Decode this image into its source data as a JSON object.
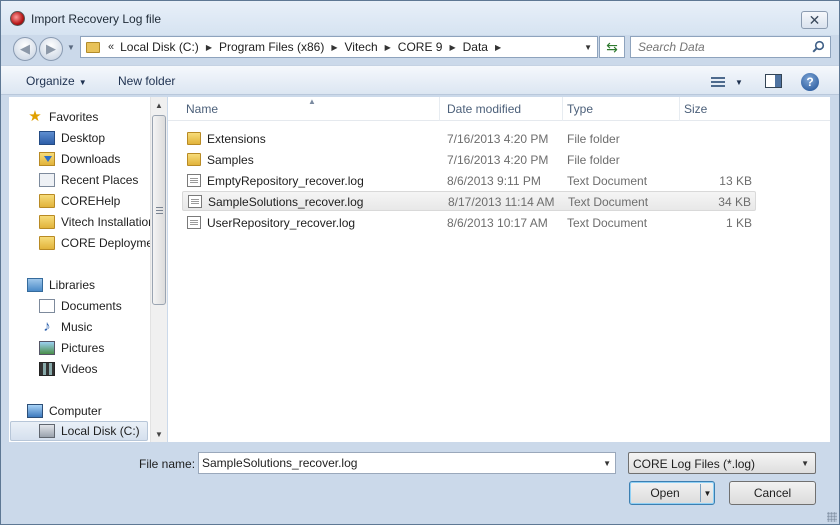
{
  "window": {
    "title": "Import Recovery Log file",
    "close_glyph": "✕"
  },
  "address": {
    "overflow": "«",
    "crumbs": [
      "Local Disk (C:)",
      "Program Files (x86)",
      "Vitech",
      "CORE 9",
      "Data"
    ],
    "search_placeholder": "Search Data"
  },
  "toolbar": {
    "organize_label": "Organize",
    "new_folder_label": "New folder",
    "help_glyph": "?"
  },
  "nav": {
    "favorites_label": "Favorites",
    "favorites": [
      "Desktop",
      "Downloads",
      "Recent Places",
      "COREHelp",
      "Vitech Installation",
      "CORE Deployment"
    ],
    "libraries_label": "Libraries",
    "libraries": [
      "Documents",
      "Music",
      "Pictures",
      "Videos"
    ],
    "computer_label": "Computer",
    "computer_items": [
      "Local Disk (C:)"
    ],
    "selected": "Local Disk (C:)"
  },
  "columns": {
    "name": "Name",
    "date": "Date modified",
    "type": "Type",
    "size": "Size"
  },
  "files": [
    {
      "name": "Extensions",
      "date": "7/16/2013 4:20 PM",
      "type": "File folder",
      "size": "",
      "kind": "folder"
    },
    {
      "name": "Samples",
      "date": "7/16/2013 4:20 PM",
      "type": "File folder",
      "size": "",
      "kind": "folder"
    },
    {
      "name": "EmptyRepository_recover.log",
      "date": "8/6/2013 9:11 PM",
      "type": "Text Document",
      "size": "13 KB",
      "kind": "text"
    },
    {
      "name": "SampleSolutions_recover.log",
      "date": "8/17/2013 11:14 AM",
      "type": "Text Document",
      "size": "34 KB",
      "kind": "text",
      "selected": true
    },
    {
      "name": "UserRepository_recover.log",
      "date": "8/6/2013 10:17 AM",
      "type": "Text Document",
      "size": "1 KB",
      "kind": "text"
    }
  ],
  "bottom": {
    "filename_label": "File name:",
    "filename_value": "SampleSolutions_recover.log",
    "filter_value": "CORE Log Files (*.log)",
    "open_label": "Open",
    "cancel_label": "Cancel"
  }
}
